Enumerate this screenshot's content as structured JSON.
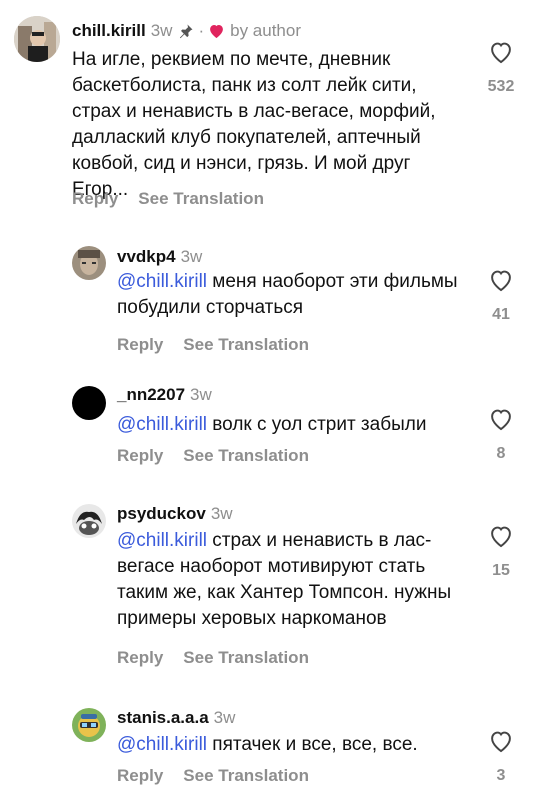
{
  "comments": [
    {
      "username": "chill.kirill",
      "age": "3w",
      "pinned": true,
      "liked_by_author_label": "by author",
      "text": "На игле, реквием по мечте, дневник баскетболиста, панк из солт лейк сити, страх и ненависть в лас-вегасе, морфий, даллаский клуб покупателей, аптечный ковбой, сид и нэнси, грязь. И мой друг Егор...",
      "reply_label": "Reply",
      "translate_label": "See Translation",
      "like_count": "532"
    },
    {
      "username": "vvdkp4",
      "age": "3w",
      "mention": "@chill.kirill",
      "text": "меня наоборот эти фильмы побудили сторчаться",
      "reply_label": "Reply",
      "translate_label": "See Translation",
      "like_count": "41"
    },
    {
      "username": "_nn2207",
      "age": "3w",
      "mention": "@chill.kirill",
      "text": "волк с уол стрит забыли",
      "reply_label": "Reply",
      "translate_label": "See Translation",
      "like_count": "8"
    },
    {
      "username": "psyduckov",
      "age": "3w",
      "mention": "@chill.kirill",
      "text": "страх и ненависть в лас-вегасе наоборот мотивируют стать таким же, как Хантер Томпсон. нужны примеры херовых наркоманов",
      "reply_label": "Reply",
      "translate_label": "See Translation",
      "like_count": "15"
    },
    {
      "username": "stanis.a.a.a",
      "age": "3w",
      "mention": "@chill.kirill",
      "text": "пятачек и все, все, все.",
      "reply_label": "Reply",
      "translate_label": "See Translation",
      "like_count": "3"
    }
  ],
  "colors": {
    "mention": "#3b5bdb",
    "secondary_text": "#8e8e8e",
    "author_heart": "#e0245e"
  },
  "icons": [
    "pin-icon",
    "heart-filled-icon",
    "heart-outline-icon"
  ]
}
